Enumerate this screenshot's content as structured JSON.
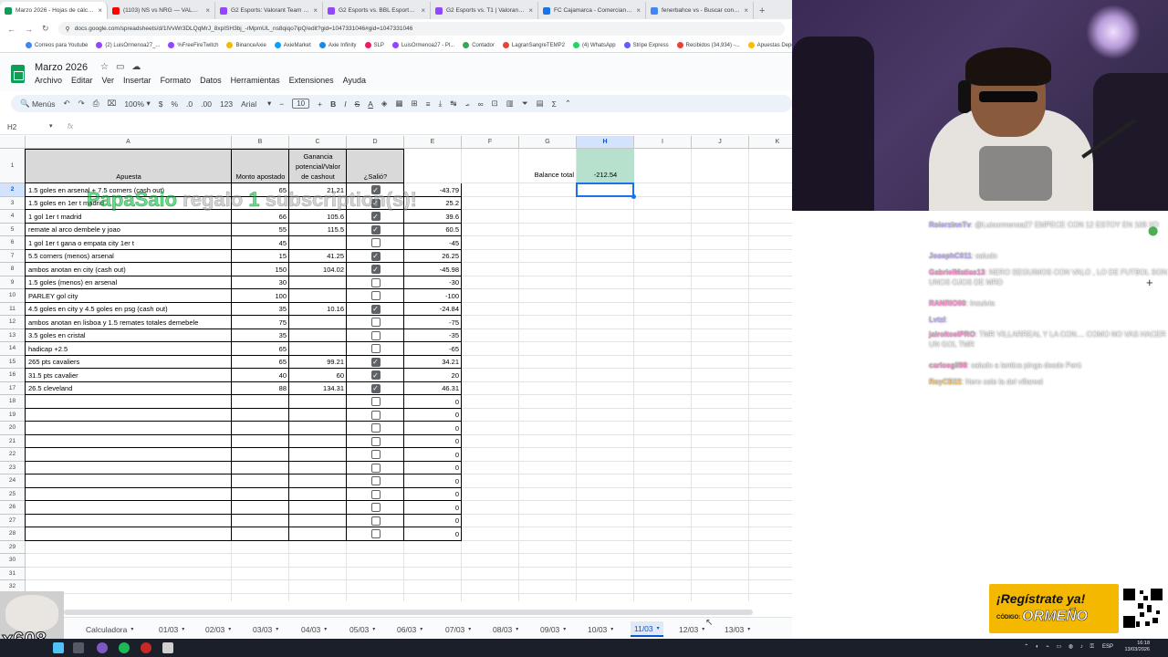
{
  "browser": {
    "tabs": [
      {
        "title": "Marzo 2026 - Hojas de cálculo",
        "active": true,
        "color": "#0f9d58"
      },
      {
        "title": "(1103) NS vs NRG — VALORANT",
        "active": false,
        "color": "#ff0000"
      },
      {
        "title": "G2 Esports: Valorant Team Profi",
        "active": false,
        "color": "#9146ff"
      },
      {
        "title": "G2 Esports vs. BBL Esports | Va",
        "active": false,
        "color": "#9146ff"
      },
      {
        "title": "G2 Esports vs. T1 | Valorant Ma",
        "active": false,
        "color": "#9146ff"
      },
      {
        "title": "FC Cajamarca - Comerciantes",
        "active": false,
        "color": "#1a73e8"
      },
      {
        "title": "fenerbahce vs - Buscar con Go",
        "active": false,
        "color": "#4285f4"
      }
    ],
    "url": "docs.google.com/spreadsheets/d/1lVvWr3DLQqMrJ_8xpISH3bj_-rMpmUL_ns8qiqo7ipQ/edit?gid=1047331046#gid=1047331046",
    "bookmarks": [
      {
        "label": "Correos para Youtube",
        "color": "#4285f4"
      },
      {
        "label": "(2) LuisOrmenoa27_...",
        "color": "#9146ff"
      },
      {
        "label": "%FreeFireTwitch",
        "color": "#9146ff"
      },
      {
        "label": "BinanceAxie",
        "color": "#f0b90b"
      },
      {
        "label": "AxieMarket",
        "color": "#00a3ff"
      },
      {
        "label": "Axie Infinity",
        "color": "#1e88e5"
      },
      {
        "label": "SLP",
        "color": "#e91e63"
      },
      {
        "label": "LuisOrmenoa27 - Pl...",
        "color": "#9146ff"
      },
      {
        "label": "Contador",
        "color": "#34a853"
      },
      {
        "label": "LagranSangreTEMP2",
        "color": "#ea4335"
      },
      {
        "label": "(4) WhatsApp",
        "color": "#25d366"
      },
      {
        "label": "Stripe Express",
        "color": "#635bff"
      },
      {
        "label": "Recibidos (34,934) -...",
        "color": "#ea4335"
      },
      {
        "label": "Apuestas Deportiv...",
        "color": "#fbbc04"
      }
    ]
  },
  "sheets": {
    "title": "Marzo 2026",
    "menu": [
      "Archivo",
      "Editar",
      "Ver",
      "Insertar",
      "Formato",
      "Datos",
      "Herramientas",
      "Extensiones",
      "Ayuda"
    ],
    "toolbar": {
      "menus": "Menús",
      "zoom": "100%",
      "currency": "$",
      "percent": "%",
      "dec_dec": ".0",
      "inc_dec": ".00",
      "format_123": "123",
      "font": "Arial",
      "font_size": "10"
    },
    "name_box": "H2",
    "fx": "fx",
    "columns": [
      "A",
      "B",
      "C",
      "D",
      "E",
      "F",
      "G",
      "H",
      "I",
      "J",
      "K"
    ],
    "headers": {
      "apuesta": "Apuesta",
      "monto": "Monto apostado",
      "ganancia": "Ganancia potencial/Valor de cashout",
      "salio": "¿Salió?"
    },
    "balance_label": "Balance total",
    "balance_value": "-212.54",
    "rows": [
      {
        "a": "1.5 goles en arsenal + 7.5 corners (cash out)",
        "b": "65",
        "c": "21.21",
        "d": true,
        "e": "-43.79"
      },
      {
        "a": "1.5 goles en 1er t madrid",
        "b": "",
        "c": "",
        "d": true,
        "e": "25.2"
      },
      {
        "a": "1 gol 1er t madrid",
        "b": "66",
        "c": "105.6",
        "d": true,
        "e": "39.6"
      },
      {
        "a": "remate al arco dembele y joao",
        "b": "55",
        "c": "115.5",
        "d": true,
        "e": "60.5"
      },
      {
        "a": "1 gol 1er t gana o empata city 1er t",
        "b": "45",
        "c": "",
        "d": false,
        "e": "-45"
      },
      {
        "a": "5.5 corners (menos) arsenal",
        "b": "15",
        "c": "41.25",
        "d": true,
        "e": "26.25"
      },
      {
        "a": "ambos anotan en city (cash out)",
        "b": "150",
        "c": "104.02",
        "d": true,
        "e": "-45.98"
      },
      {
        "a": "1.5 goles (menos) en arsenal",
        "b": "30",
        "c": "",
        "d": false,
        "e": "-30"
      },
      {
        "a": "PARLEY gol city",
        "b": "100",
        "c": "",
        "d": false,
        "e": "-100"
      },
      {
        "a": "4.5 goles en city y 4.5 goles en psg (cash out)",
        "b": "35",
        "c": "10.16",
        "d": true,
        "e": "-24.84"
      },
      {
        "a": "ambos anotan en lisboa y 1.5 remates totales demebele",
        "b": "75",
        "c": "",
        "d": false,
        "e": "-75"
      },
      {
        "a": "3.5 goles en cristal",
        "b": "35",
        "c": "",
        "d": false,
        "e": "-35"
      },
      {
        "a": "hadicap +2.5",
        "b": "65",
        "c": "",
        "d": false,
        "e": "-65"
      },
      {
        "a": "265 pts cavaliers",
        "b": "65",
        "c": "99.21",
        "d": true,
        "e": "34.21"
      },
      {
        "a": "31.5 pts cavalier",
        "b": "40",
        "c": "60",
        "d": true,
        "e": "20"
      },
      {
        "a": "26.5 cleveland",
        "b": "88",
        "c": "134.31",
        "d": true,
        "e": "46.31"
      },
      {
        "a": "",
        "b": "",
        "c": "",
        "d": false,
        "e": "0"
      },
      {
        "a": "",
        "b": "",
        "c": "",
        "d": false,
        "e": "0"
      },
      {
        "a": "",
        "b": "",
        "c": "",
        "d": false,
        "e": "0"
      },
      {
        "a": "",
        "b": "",
        "c": "",
        "d": false,
        "e": "0"
      },
      {
        "a": "",
        "b": "",
        "c": "",
        "d": false,
        "e": "0"
      },
      {
        "a": "",
        "b": "",
        "c": "",
        "d": false,
        "e": "0"
      },
      {
        "a": "",
        "b": "",
        "c": "",
        "d": false,
        "e": "0"
      },
      {
        "a": "",
        "b": "",
        "c": "",
        "d": false,
        "e": "0"
      },
      {
        "a": "",
        "b": "",
        "c": "",
        "d": false,
        "e": "0"
      },
      {
        "a": "",
        "b": "",
        "c": "",
        "d": false,
        "e": "0"
      },
      {
        "a": "",
        "b": "",
        "c": "",
        "d": false,
        "e": "0"
      }
    ],
    "sheet_tabs": [
      "Calculadora",
      "01/03",
      "02/03",
      "03/03",
      "04/03",
      "05/03",
      "06/03",
      "07/03",
      "08/03",
      "09/03",
      "10/03",
      "11/03",
      "12/03",
      "13/03"
    ],
    "active_sheet": "11/03"
  },
  "overlay": {
    "user": "PapaSaio",
    "pre": "regalo",
    "count": "1",
    "post": "subscription(s)!"
  },
  "chat": [
    {
      "user": "RoierzinnTv",
      "color": "#c9b6ff",
      "text": ": @Luisormenoa27 EMPECE CON 12 ESTOY EN 108 XD"
    },
    {
      "user": "JosephC011",
      "color": "#c9b6ff",
      "text": ": saludo"
    },
    {
      "user": "GabrielMatias13",
      "color": "#ff9ad5",
      "text": ": NERO SEGUIMOS CON VALO , LO DE FUTBOL SON UNOS OJOS DE MRD"
    },
    {
      "user": "RANRIO00",
      "color": "#ff9ad5",
      "text": ": Insulvia"
    },
    {
      "user": "Lvtzl",
      "color": "#c9b6ff",
      "text": ":"
    },
    {
      "user": "jairoltoeIPRO",
      "color": "#ff9ad5",
      "text": ": TMR VILLARREAL Y LA CON.... COMO NO VAS HACER UN GOL TMR"
    },
    {
      "user": "carlosgil98",
      "color": "#ff9ad5",
      "text": ": saludo a lantica pinga desde Perú"
    },
    {
      "user": "RoyCB22",
      "color": "#ffd580",
      "text": ": Nero sale la del villareal"
    }
  ],
  "promo": {
    "headline": "¡Regístrate ya!",
    "label": "CÓDIGO:",
    "code": "ORMEÑO"
  },
  "cat": {
    "count": "x608"
  },
  "clock": {
    "time": "16:18",
    "date": "13/03/2026"
  },
  "tray_lang": "ESP"
}
